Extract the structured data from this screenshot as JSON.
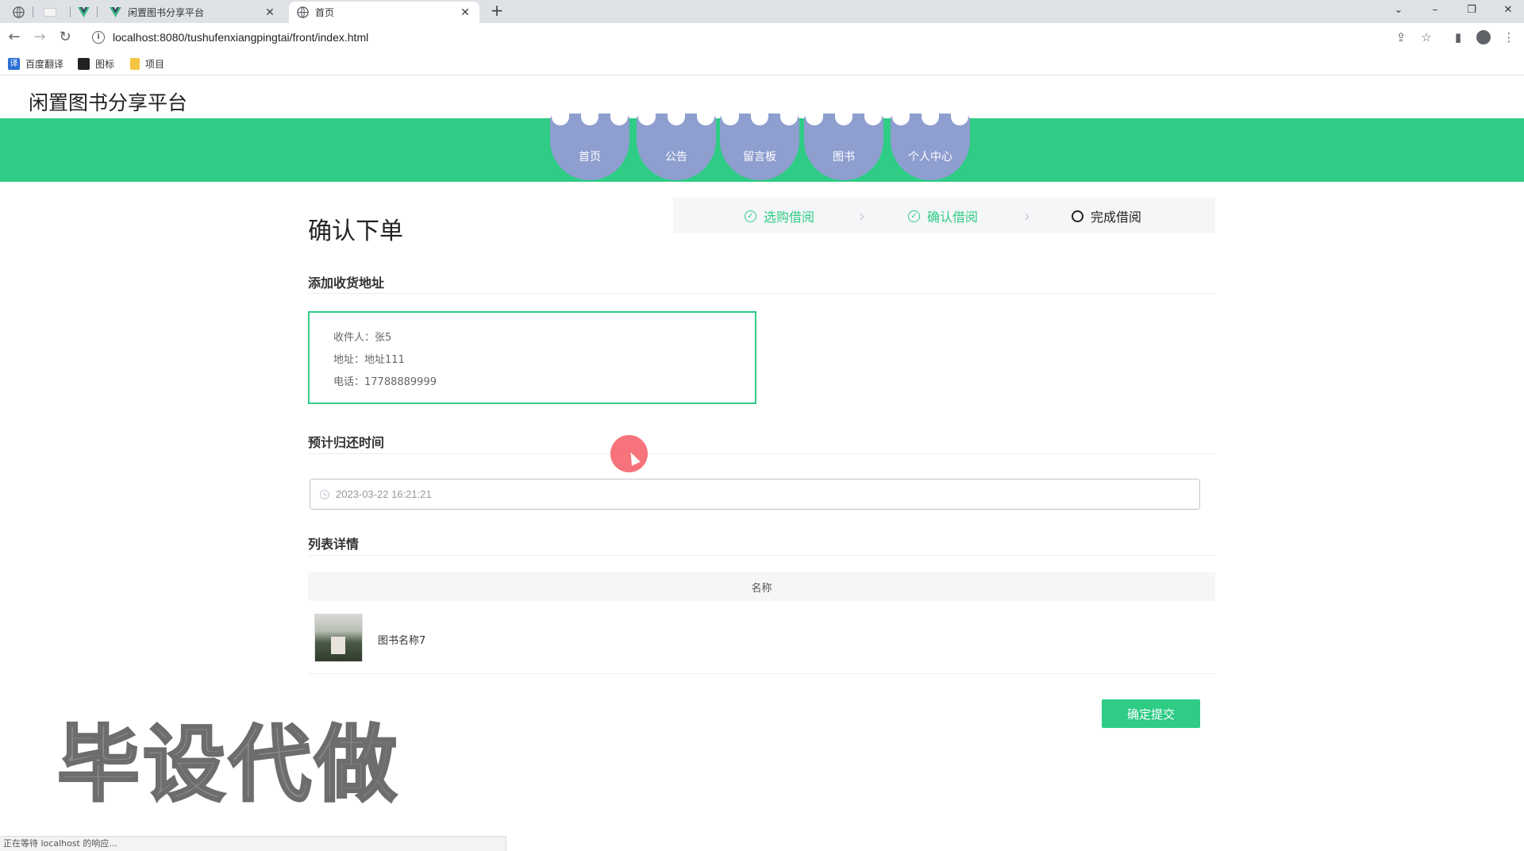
{
  "browser": {
    "tabs": [
      {
        "title": "闲置图书分享平台",
        "active": false
      },
      {
        "title": "首页",
        "active": true
      }
    ],
    "url": "localhost:8080/tushufenxiangpingtai/front/index.html",
    "bookmarks": [
      "百度翻译",
      "图标",
      "项目"
    ],
    "status_text": "正在等待 localhost 的响应..."
  },
  "site": {
    "title": "闲置图书分享平台",
    "nav": [
      "首页",
      "公告",
      "留言板",
      "图书",
      "个人中心"
    ],
    "colors": {
      "primary": "#2ecc85",
      "nav_bubble": "#8e9ecf"
    }
  },
  "order": {
    "heading": "确认下单",
    "steps": [
      {
        "label": "选购借阅",
        "state": "done"
      },
      {
        "label": "确认借阅",
        "state": "done"
      },
      {
        "label": "完成借阅",
        "state": "current"
      }
    ],
    "address_section": "添加收货地址",
    "address": {
      "recipient": "收件人：张5",
      "location": "地址：地址111",
      "phone": "电话：17788889999"
    },
    "return_section": "预计归还时间",
    "return_time": "2023-03-22 16:21:21",
    "list_section": "列表详情",
    "table": {
      "header": "名称",
      "rows": [
        {
          "name": "图书名称7"
        }
      ]
    },
    "submit_label": "确定提交"
  },
  "watermark": "毕设代做"
}
